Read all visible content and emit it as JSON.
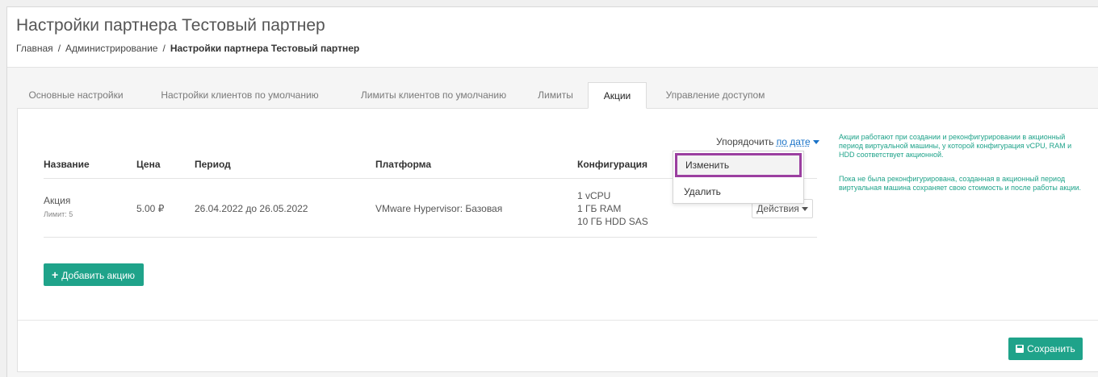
{
  "header": {
    "title": "Настройки партнера Тестовый партнер",
    "breadcrumb": {
      "home": "Главная",
      "admin": "Администрирование",
      "current": "Настройки партнера Тестовый партнер"
    }
  },
  "tabs": [
    {
      "label": "Основные настройки",
      "active": false
    },
    {
      "label": "Настройки клиентов по умолчанию",
      "active": false
    },
    {
      "label": "Лимиты клиентов по умолчанию",
      "active": false
    },
    {
      "label": "Лимиты",
      "active": false
    },
    {
      "label": "Акции",
      "active": true
    },
    {
      "label": "Управление доступом",
      "active": false
    }
  ],
  "sort": {
    "label": "Упорядочить",
    "value": "по дате"
  },
  "table": {
    "columns": [
      "Название",
      "Цена",
      "Период",
      "Платформа",
      "Конфигурация"
    ],
    "rows": [
      {
        "name": "Акция",
        "limit": "Лимит: 5",
        "price": "5.00 ₽",
        "period": "26.04.2022 до 26.05.2022",
        "platform": "VMware Hypervisor: Базовая",
        "config": [
          "1 vCPU",
          "1 ГБ RAM",
          "10 ГБ HDD SAS"
        ],
        "actions_label": "Действия"
      }
    ]
  },
  "dropdown": {
    "items": [
      "Изменить",
      "Удалить"
    ]
  },
  "buttons": {
    "add": "Добавить акцию",
    "save": "Сохранить"
  },
  "hints": [
    "Акции работают при создании и реконфигурировании в акционный период виртуальной машины, у которой конфигурация vCPU, RAM и HDD соответствует акционной.",
    "Пока не была реконфигурирована, созданная в акционный период виртуальная машина сохраняет свою стоимость и после работы акции."
  ],
  "colors": {
    "accent": "#1fa38a",
    "link": "#1a73c8",
    "highlight": "#9b3fa0"
  }
}
